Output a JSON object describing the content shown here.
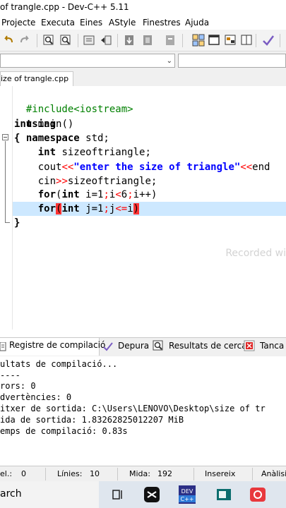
{
  "window": {
    "title": "of trangle.cpp - Dev-C++ 5.11"
  },
  "menu": {
    "items": [
      "Projecte",
      "Executa",
      "Eines",
      "AStyle",
      "Finestres",
      "Ajuda"
    ]
  },
  "toolbar": {
    "icons": [
      "undo-icon",
      "redo-icon",
      "find-icon",
      "replace-icon",
      "indent-icon",
      "unindent-icon",
      "bookmark-toggle-icon",
      "goto-bookmark-icon",
      "grid-icon",
      "window-icon",
      "class-browser-icon",
      "check-icon"
    ]
  },
  "file_tab": {
    "label": "ize of trangle.cpp"
  },
  "editor": {
    "lines": [
      "#include<iostream>",
      "using namespace std;",
      "int main()",
      "{",
      "    int sizeoftriangle;",
      "    cout<<\"enter the size of triangle\"<<end",
      "    cin>>sizeoftriangle;",
      "    for(int i=1;i<6;i++)",
      "    for(int j=1;j<=i)",
      "}"
    ],
    "tokens": {
      "include": "#include<iostream>",
      "using": "using",
      "namespace": "namespace",
      "std": " std;",
      "int": "int",
      "main": " main()",
      "brace_open": "{",
      "brace_close": "}",
      "decl_name": " sizeoftriangle;",
      "cout": "cout",
      "shl": "<<",
      "string": "\"enter the size of triangle\"",
      "end": "end",
      "cin": "cin",
      "shr": ">>",
      "cin_var": "sizeoftriangle;",
      "for": "for",
      "paren_open": "(",
      "paren_close": ")",
      "i_init": " i=",
      "one": "1",
      "semi": ";",
      "i": "i",
      "lt": "<",
      "six": "6",
      "iinc": "i++",
      "j_init": " j=",
      "j": "j",
      "le": "<=",
      "i2": "i"
    },
    "watermark": "Recorded wi"
  },
  "bottom_tabs": [
    {
      "label": "Registre de compilació",
      "icon": "compile-log-icon"
    },
    {
      "label": "Depura",
      "icon": "debug-check-icon"
    },
    {
      "label": "Resultats de cerca",
      "icon": "search-results-icon"
    },
    {
      "label": "Tanca",
      "icon": "close-panel-icon"
    }
  ],
  "compile_output": {
    "lines": [
      "ultats de compilació...",
      "----",
      "rors: 0",
      "dvertències: 0",
      "itxer de sortida: C:\\Users\\LENOVO\\Desktop\\size of tr",
      "ida de sortida: 1.83262825012207 MiB",
      "emps de compilació: 0.83s"
    ]
  },
  "status": {
    "sel_label": "el.:",
    "sel_value": "0",
    "lines_label": "Línies:",
    "lines_value": "10",
    "size_label": "Mida:",
    "size_value": "192",
    "mode": "Insereix",
    "analysis": "Anàlisi"
  },
  "taskbar": {
    "search_text": "arch"
  },
  "colors": {
    "highlight": "#cde8ff",
    "bracket_match": "#ff3333",
    "keyword": "#000000",
    "string": "#0000ff",
    "preprocessor": "#008000"
  }
}
